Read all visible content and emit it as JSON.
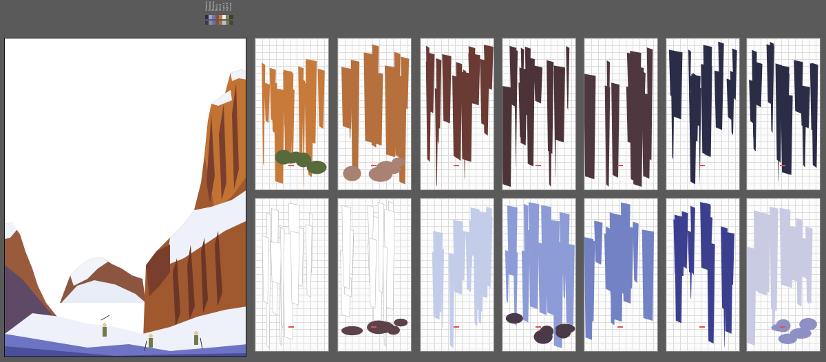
{
  "swatches": {
    "labels": [
      "Shadow A",
      "Shadow B",
      "Shadow C",
      "Mid A",
      "Mid B",
      "Light A",
      "Light B",
      "Accent"
    ],
    "colors": [
      "#2a2d4a",
      "#9aa3cf",
      "#6f76b8",
      "#8a5240",
      "#c77a3a",
      "#e7ecf6",
      "#7a8a4a",
      "#3b3f2f"
    ]
  },
  "sheets_row1": [
    {
      "name": "sheet-orange-green-pieces",
      "color": "#c77a3a",
      "accent": "#566a3c"
    },
    {
      "name": "sheet-copper-pieces",
      "color": "#b5703d",
      "accent": "#a98274"
    },
    {
      "name": "sheet-brown-pieces",
      "color": "#6a3a35",
      "accent": "#6a3a35"
    },
    {
      "name": "sheet-dark-brown-pieces",
      "color": "#4c3338",
      "accent": "#4c3338"
    },
    {
      "name": "sheet-plum-pieces",
      "color": "#4f3740",
      "accent": "#4f3740"
    },
    {
      "name": "sheet-navy-pieces",
      "color": "#2b2c48",
      "accent": "#2b2c48"
    },
    {
      "name": "sheet-midnight-pieces",
      "color": "#2b2d47",
      "accent": "#2b2d47"
    }
  ],
  "sheets_row2": [
    {
      "name": "sheet-white-outline-pieces",
      "color": "#ffffff",
      "accent": "#ffffff"
    },
    {
      "name": "sheet-white-and-brown-pieces",
      "color": "#ffffff",
      "accent": "#5b4248"
    },
    {
      "name": "sheet-pale-blue-pieces",
      "color": "#c3cdea",
      "accent": "#c3cdea"
    },
    {
      "name": "sheet-blue-and-dark-pieces",
      "color": "#8d9cd6",
      "accent": "#4a3a48"
    },
    {
      "name": "sheet-periwinkle-pieces",
      "color": "#7282c4",
      "accent": "#7282c4"
    },
    {
      "name": "sheet-indigo-pieces",
      "color": "#3c3f8f",
      "accent": "#3c3f8f"
    },
    {
      "name": "sheet-lavender-pieces",
      "color": "#c9cbe3",
      "accent": "#8e8fc2"
    }
  ]
}
